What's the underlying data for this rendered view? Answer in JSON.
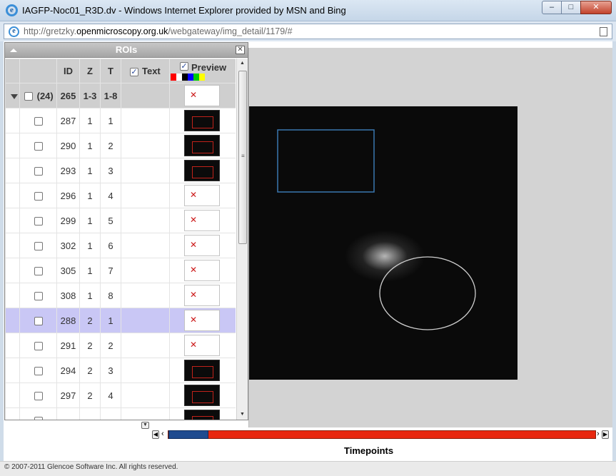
{
  "window": {
    "title": "IAGFP-Noc01_R3D.dv - Windows Internet Explorer provided by MSN and Bing",
    "ie_icon": "internet-explorer-icon",
    "buttons": {
      "minimize": "‒",
      "maximize": "□",
      "close": "✕"
    }
  },
  "address": {
    "prefix": "http://gretzky.",
    "domain": "openmicroscopy.org.uk",
    "path": "/webgateway/img_detail/1179/#"
  },
  "roi_panel": {
    "title": "ROIs",
    "close_glyph": "✕",
    "headers": {
      "id": "ID",
      "z": "Z",
      "t": "T",
      "text": "Text",
      "preview": "Preview"
    },
    "text_checked": true,
    "preview_checked": true,
    "swatch_colors": [
      "#ff0000",
      "#ffffff",
      "#000000",
      "#0000ff",
      "#00cc00",
      "#ffff00"
    ],
    "group": {
      "count": "(24)",
      "id": "265",
      "z": "1-3",
      "t": "1-8"
    },
    "rows": [
      {
        "id": "287",
        "z": "1",
        "t": "1",
        "thumb": "dark",
        "selected": false
      },
      {
        "id": "290",
        "z": "1",
        "t": "2",
        "thumb": "dark",
        "selected": false
      },
      {
        "id": "293",
        "z": "1",
        "t": "3",
        "thumb": "dark",
        "selected": false
      },
      {
        "id": "296",
        "z": "1",
        "t": "4",
        "thumb": "broken",
        "selected": false
      },
      {
        "id": "299",
        "z": "1",
        "t": "5",
        "thumb": "broken",
        "selected": false
      },
      {
        "id": "302",
        "z": "1",
        "t": "6",
        "thumb": "broken",
        "selected": false
      },
      {
        "id": "305",
        "z": "1",
        "t": "7",
        "thumb": "broken",
        "selected": false
      },
      {
        "id": "308",
        "z": "1",
        "t": "8",
        "thumb": "broken",
        "selected": false
      },
      {
        "id": "288",
        "z": "2",
        "t": "1",
        "thumb": "broken",
        "selected": true
      },
      {
        "id": "291",
        "z": "2",
        "t": "2",
        "thumb": "broken",
        "selected": false
      },
      {
        "id": "294",
        "z": "2",
        "t": "3",
        "thumb": "dark",
        "selected": false
      },
      {
        "id": "297",
        "z": "2",
        "t": "4",
        "thumb": "dark",
        "selected": false
      },
      {
        "id": "",
        "z": "",
        "t": "",
        "thumb": "dark",
        "selected": false
      }
    ]
  },
  "viewer": {
    "rect_roi_color": "#3b78b0",
    "ellipse_roi_color": "#cfcfcf"
  },
  "timeline": {
    "label": "Timepoints",
    "first": "◀",
    "prev": "‹",
    "next": "›",
    "last": "▶",
    "position_fraction": 0.047,
    "expand_glyph": "▼"
  },
  "footer": {
    "copyright": "© 2007-2011 Glencoe Software Inc. All rights reserved."
  }
}
